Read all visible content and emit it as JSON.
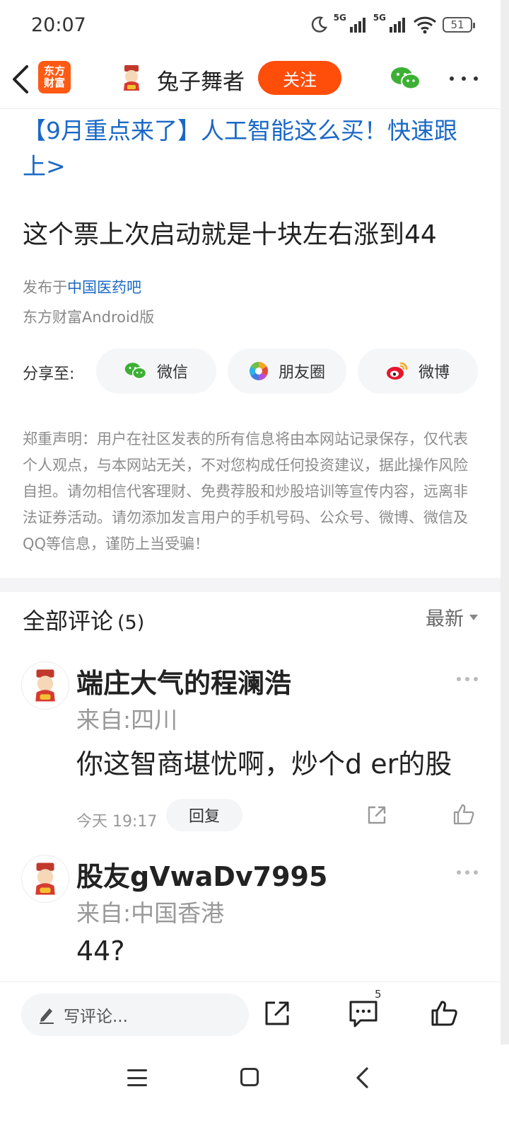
{
  "status_bar": {
    "time": "20:07",
    "network1": "5G",
    "network2": "5G",
    "battery": "51"
  },
  "header": {
    "app_logo_line1": "东方",
    "app_logo_line2": "财富",
    "author_name": "兔子舞者",
    "follow_label": "关注"
  },
  "post": {
    "promo_link": "【9月重点来了】人工智能这么买！快速跟上>",
    "title": "这个票上次启动就是十块左右涨到44",
    "published_prefix": "发布于",
    "board_name": "中国医药吧",
    "client": "东方财富Android版"
  },
  "share": {
    "label": "分享至:",
    "wechat": "微信",
    "moments": "朋友圈",
    "weibo": "微博"
  },
  "disclaimer": "郑重声明：用户在社区发表的所有信息将由本网站记录保存，仅代表个人观点，与本网站无关，不对您构成任何投资建议，据此操作风险自担。请勿相信代客理财、免费荐股和炒股培训等宣传内容，远离非法证券活动。请勿添加发言用户的手机号码、公众号、微博、微信及QQ等信息，谨防上当受骗！",
  "comments": {
    "title": "全部评论",
    "count": "(5)",
    "sort_label": "最新",
    "items": [
      {
        "name": "端庄大气的程澜浩",
        "location": "来自:四川",
        "text": "你这智商堪忧啊，炒个d er的股",
        "time": "今天 19:17",
        "reply_label": "回复"
      },
      {
        "name": "股友gVwaDv7995",
        "location": "来自:中国香港",
        "text": "44?"
      }
    ]
  },
  "bottom_bar": {
    "input_placeholder": "写评论...",
    "comment_count": "5"
  },
  "colors": {
    "accent_orange": "#ff4d0a",
    "link_blue": "#1a68c6",
    "wechat_green": "#3cb034",
    "weibo_red": "#e6162d"
  }
}
